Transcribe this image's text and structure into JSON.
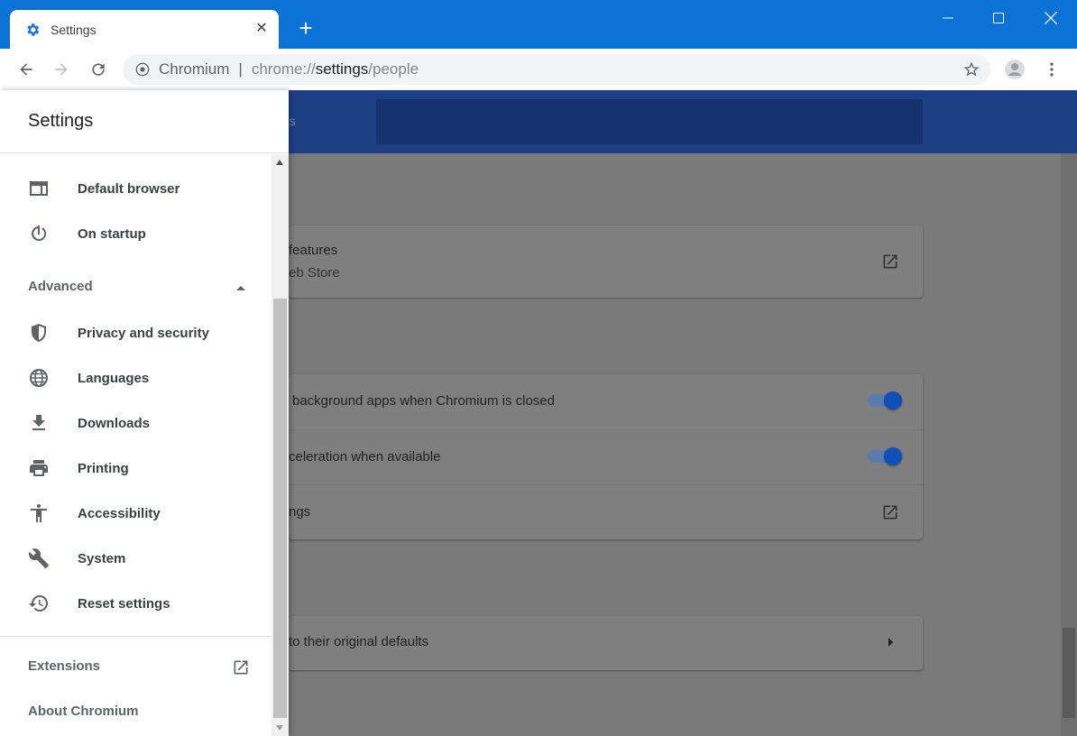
{
  "window": {
    "tab_title": "Settings",
    "tab_close": "✕",
    "new_tab": "+"
  },
  "toolbar": {
    "site_name": "Chromium",
    "separator": "|",
    "url_scheme": "chrome://",
    "url_host": "settings",
    "url_path": "/people"
  },
  "page": {
    "header_title_fragment": "ngs",
    "cards": [
      {
        "rows": [
          {
            "text": "features",
            "subtext": "eb Store",
            "control": "external-link"
          }
        ]
      },
      {
        "rows": [
          {
            "text": "background apps when Chromium is closed",
            "control": "toggle",
            "on": true
          },
          {
            "text": "celeration when available",
            "control": "toggle",
            "on": true
          },
          {
            "text": "ngs",
            "control": "external-link"
          }
        ]
      },
      {
        "rows": [
          {
            "text": "to their original defaults",
            "control": "chevron"
          }
        ]
      }
    ]
  },
  "drawer": {
    "title": "Settings",
    "items": [
      {
        "label": "Default browser",
        "icon": "browser-window-icon"
      },
      {
        "label": "On startup",
        "icon": "power-icon"
      }
    ],
    "advanced_label": "Advanced",
    "advanced_items": [
      {
        "label": "Privacy and security",
        "icon": "shield-icon"
      },
      {
        "label": "Languages",
        "icon": "globe-icon"
      },
      {
        "label": "Downloads",
        "icon": "download-icon"
      },
      {
        "label": "Printing",
        "icon": "printer-icon"
      },
      {
        "label": "Accessibility",
        "icon": "accessibility-icon"
      },
      {
        "label": "System",
        "icon": "wrench-icon"
      },
      {
        "label": "Reset settings",
        "icon": "history-icon"
      }
    ],
    "extensions_label": "Extensions",
    "about_label": "About Chromium"
  },
  "colors": {
    "titlebar": "#0b72d6",
    "header": "#1c3f86",
    "toggle_on": "#0f4fb8"
  }
}
